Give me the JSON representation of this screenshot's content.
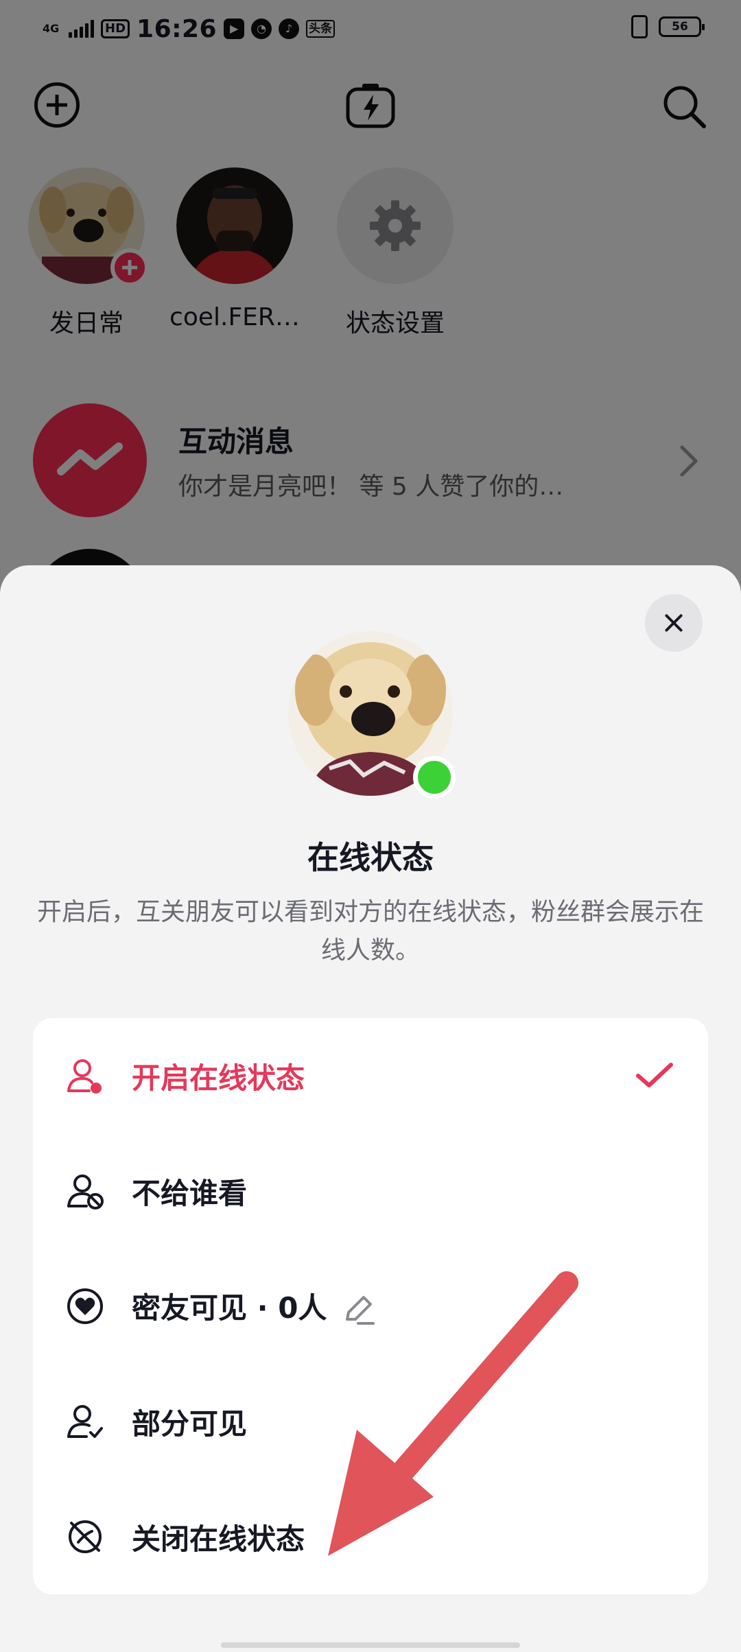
{
  "status_bar": {
    "network": "4G",
    "hd": "HD",
    "time": "16:26",
    "app_badge": "头条",
    "battery": "56"
  },
  "stories": [
    {
      "name": "发日常"
    },
    {
      "name": "coel.FER…"
    },
    {
      "name": "状态设置"
    }
  ],
  "messages": {
    "interaction_title": "互动消息",
    "interaction_preview": "你才是月亮吧！ 等 5 人赞了你的…"
  },
  "sheet": {
    "title": "在线状态",
    "description": "开启后，互关朋友可以看到对方的在线状态，粉丝群会展示在线人数。",
    "options": [
      {
        "label": "开启在线状态",
        "icon": "person-dot-icon",
        "selected": true
      },
      {
        "label": "不给谁看",
        "icon": "person-block-icon",
        "selected": false
      },
      {
        "label": "密友可见 · 0人",
        "icon": "heart-circle-icon",
        "selected": false
      },
      {
        "label": "部分可见",
        "icon": "person-check-icon",
        "selected": false
      },
      {
        "label": "关闭在线状态",
        "icon": "status-off-icon",
        "selected": false
      }
    ]
  },
  "colors": {
    "accent": "#e5385a",
    "brand_red": "#fe2c55",
    "online_green": "#3cd136",
    "annotation_arrow": "#e0545a"
  }
}
